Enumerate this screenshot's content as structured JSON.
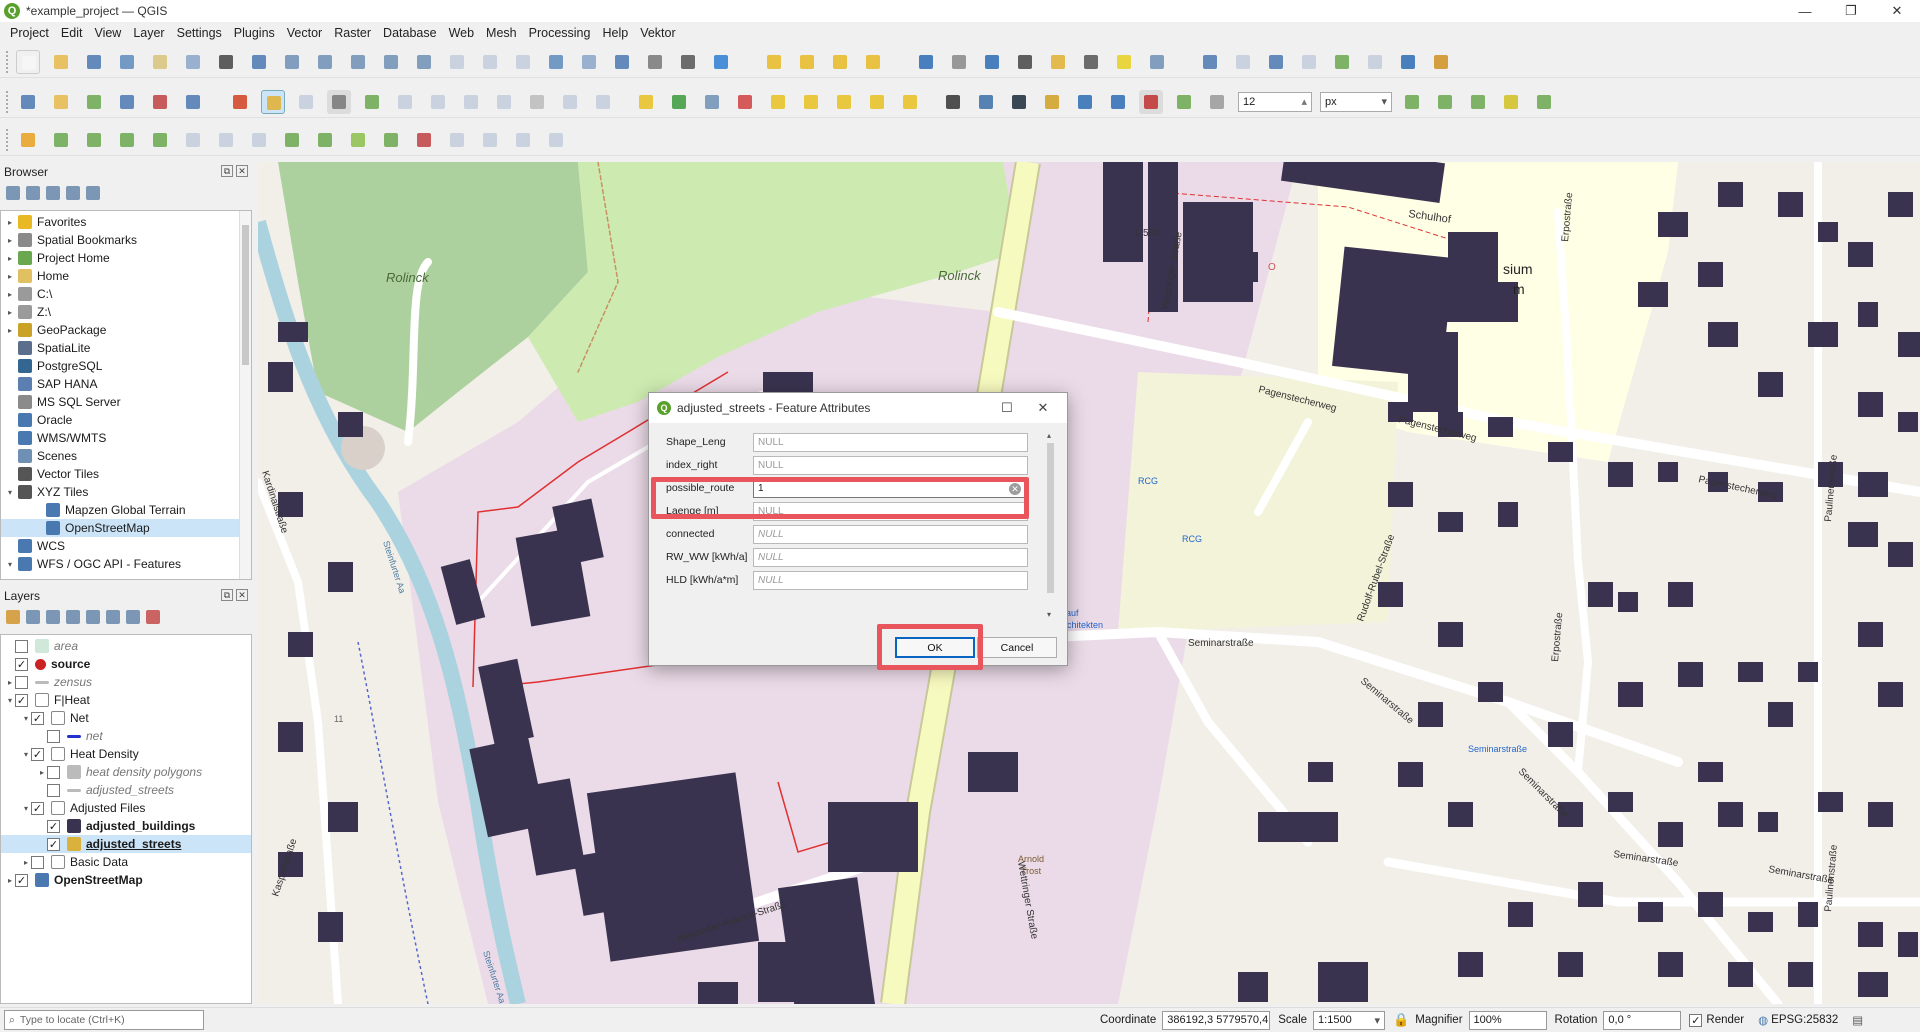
{
  "window": {
    "title": "*example_project — QGIS",
    "minimize": "—",
    "maximize": "❐",
    "close": "✕"
  },
  "menu": [
    "Project",
    "Edit",
    "View",
    "Layer",
    "Settings",
    "Plugins",
    "Vector",
    "Raster",
    "Database",
    "Web",
    "Mesh",
    "Processing",
    "Help",
    "Vektor"
  ],
  "toolbar": {
    "snap_tolerance": "12",
    "snap_units": "px"
  },
  "browser": {
    "title": "Browser",
    "items": [
      {
        "label": "Favorites",
        "icon": "star-icon",
        "color": "#e8b925",
        "expand": "▸"
      },
      {
        "label": "Spatial Bookmarks",
        "icon": "bookmark-icon",
        "color": "#8a8a8a",
        "expand": "▸"
      },
      {
        "label": "Project Home",
        "icon": "folder-icon",
        "color": "#6aa84f",
        "expand": "▸"
      },
      {
        "label": "Home",
        "icon": "folder-icon",
        "color": "#e0c060",
        "expand": "▸"
      },
      {
        "label": "C:\\",
        "icon": "drive-icon",
        "color": "#9a9a9a",
        "expand": "▸"
      },
      {
        "label": "Z:\\",
        "icon": "drive-icon",
        "color": "#9a9a9a",
        "expand": "▸"
      },
      {
        "label": "GeoPackage",
        "icon": "geopackage-icon",
        "color": "#c9a227",
        "expand": "▸"
      },
      {
        "label": "SpatiaLite",
        "icon": "spatialite-icon",
        "color": "#5b6f8c",
        "expand": ""
      },
      {
        "label": "PostgreSQL",
        "icon": "postgresql-icon",
        "color": "#336791",
        "expand": ""
      },
      {
        "label": "SAP HANA",
        "icon": "hana-icon",
        "color": "#5a7fb0",
        "expand": ""
      },
      {
        "label": "MS SQL Server",
        "icon": "mssql-icon",
        "color": "#8a8a8a",
        "expand": ""
      },
      {
        "label": "Oracle",
        "icon": "oracle-icon",
        "color": "#4a78b0",
        "expand": ""
      },
      {
        "label": "WMS/WMTS",
        "icon": "globe-icon",
        "color": "#4a78b0",
        "expand": ""
      },
      {
        "label": "Scenes",
        "icon": "scene-icon",
        "color": "#6f8fb5",
        "expand": ""
      },
      {
        "label": "Vector Tiles",
        "icon": "grid-icon",
        "color": "#555",
        "expand": ""
      },
      {
        "label": "XYZ Tiles",
        "icon": "grid-icon",
        "color": "#555",
        "expand": "▾"
      },
      {
        "label": "Mapzen Global Terrain",
        "icon": "grid-icon",
        "color": "#4a78b0",
        "expand": "",
        "indent": 1
      },
      {
        "label": "OpenStreetMap",
        "icon": "grid-icon",
        "color": "#4a78b0",
        "expand": "",
        "indent": 1,
        "selected": true
      },
      {
        "label": "WCS",
        "icon": "globe-icon",
        "color": "#4a78b0",
        "expand": ""
      },
      {
        "label": "WFS / OGC API - Features",
        "icon": "globe-icon",
        "color": "#4a78b0",
        "expand": "▾"
      }
    ]
  },
  "layers": {
    "title": "Layers",
    "items": [
      {
        "label": "area",
        "checked": false,
        "style": "it",
        "icon": "polygon-icon",
        "color": "#cfe8d9",
        "level": 0,
        "expand": ""
      },
      {
        "label": "source",
        "checked": true,
        "style": "bold",
        "icon": "point-icon",
        "color": "#cc2222",
        "level": 0,
        "expand": ""
      },
      {
        "label": "zensus",
        "checked": false,
        "style": "it",
        "icon": "line-icon",
        "color": "#bbbbbb",
        "level": 0,
        "expand": "▸"
      },
      {
        "label": "F|Heat",
        "checked": true,
        "style": "",
        "icon": "group-icon",
        "color": "#999",
        "level": 0,
        "expand": "▾"
      },
      {
        "label": "Net",
        "checked": true,
        "style": "",
        "icon": "group-icon",
        "color": "#999",
        "level": 1,
        "expand": "▾"
      },
      {
        "label": "net",
        "checked": false,
        "style": "it",
        "icon": "line-icon",
        "color": "#2233cc",
        "level": 2,
        "expand": ""
      },
      {
        "label": "Heat Density",
        "checked": true,
        "style": "",
        "icon": "group-icon",
        "color": "#999",
        "level": 1,
        "expand": "▾"
      },
      {
        "label": "heat density polygons",
        "checked": false,
        "style": "it",
        "icon": "polygon-icon",
        "color": "#bbbbbb",
        "level": 2,
        "expand": "▸"
      },
      {
        "label": "adjusted_streets",
        "checked": false,
        "style": "it",
        "icon": "line-icon",
        "color": "#bbbbbb",
        "level": 2,
        "expand": ""
      },
      {
        "label": "Adjusted Files",
        "checked": true,
        "style": "",
        "icon": "group-icon",
        "color": "#999",
        "level": 1,
        "expand": "▾"
      },
      {
        "label": "adjusted_buildings",
        "checked": true,
        "style": "bold",
        "icon": "polygon-icon",
        "color": "#3a3350",
        "level": 2,
        "expand": ""
      },
      {
        "label": "adjusted_streets",
        "checked": true,
        "style": "bold underline",
        "icon": "pencil-icon",
        "color": "#d9b13b",
        "level": 2,
        "expand": "",
        "selected": true
      },
      {
        "label": "Basic Data",
        "checked": false,
        "style": "",
        "icon": "group-icon",
        "color": "#999",
        "level": 1,
        "expand": "▸"
      },
      {
        "label": "OpenStreetMap",
        "checked": true,
        "style": "bold",
        "icon": "raster-icon",
        "color": "#4a78b0",
        "level": 0,
        "expand": "▸"
      }
    ]
  },
  "map_labels": {
    "rolinck_park": "Rolinck",
    "rolinck_meadow": "Rolinck",
    "schulhof": "Schulhof",
    "l580": "L 580",
    "wettringer1": "Wettringer Straße",
    "wettringer2": "Wettringer Straße",
    "pagenstecher1": "Pagenstecherweg",
    "pagenstecher2": "Pagenstecherweg",
    "pagenstecher3": "Pagenstecherweg",
    "seminar1": "Seminarstraße",
    "seminar2": "Seminarstraße",
    "seminar3": "Seminarstraße",
    "seminar4": "Seminarstraße",
    "seminar5": "Seminarstraße",
    "seminar_stop": "Seminarstraße",
    "rudolf": "Rudolf-Rubel-Straße",
    "erpostr1": "Erpostraße",
    "erpostr2": "Erpostraße",
    "paulinen1": "Paulinenstraße",
    "paulinen2": "Paulinenstraße",
    "alexander": "Alexander-Rolinck-Straße",
    "steinfurter1": "Steinfurter Aa",
    "steinfurter2": "Steinfurter Aa",
    "kardinal": "Kardinalstraße",
    "kaspar": "Kasparstraße",
    "gymnasium": "sium",
    "gymnasium2": "m",
    "rcg1": "RCG",
    "rcg2": "RCG",
    "architekten": "Architekten",
    "auf": "auf",
    "arnold": "Arnold",
    "trost": "Trost",
    "num11": "11",
    "od": "O"
  },
  "dialog": {
    "title": "adjusted_streets - Feature Attributes",
    "fields": [
      {
        "label": "Shape_Leng",
        "value": "NULL",
        "is_null": true
      },
      {
        "label": "index_right",
        "value": "NULL",
        "is_null": true
      },
      {
        "label": "possible_route",
        "value": "1",
        "is_null": false
      },
      {
        "label": "Laenge [m]",
        "value": "NULL",
        "is_null": true
      },
      {
        "label": "connected",
        "value": "NULL",
        "is_null": true
      },
      {
        "label": "RW_WW [kWh/a]",
        "value": "NULL",
        "is_null": true
      },
      {
        "label": "HLD [kWh/a*m]",
        "value": "NULL",
        "is_null": true
      }
    ],
    "ok_label": "OK",
    "cancel_label": "Cancel"
  },
  "highlight_color": "#e8555c",
  "status": {
    "locator_placeholder": "Type to locate (Ctrl+K)",
    "coordinate_label": "Coordinate",
    "coordinate_value": "386192,3  5779570,4",
    "scale_label": "Scale",
    "scale_value": "1:1500",
    "magnifier_label": "Magnifier",
    "magnifier_value": "100%",
    "rotation_label": "Rotation",
    "rotation_value": "0,0 °",
    "render_label": "Render",
    "crs": "EPSG:25832"
  },
  "colors": {
    "building": "#3a3350",
    "industrial": "#ebdbe8",
    "park": "#add19e",
    "meadow": "#cdebb0",
    "school": "#ffffe5",
    "road_primary": "#f7fabf",
    "river": "#aad3df"
  }
}
